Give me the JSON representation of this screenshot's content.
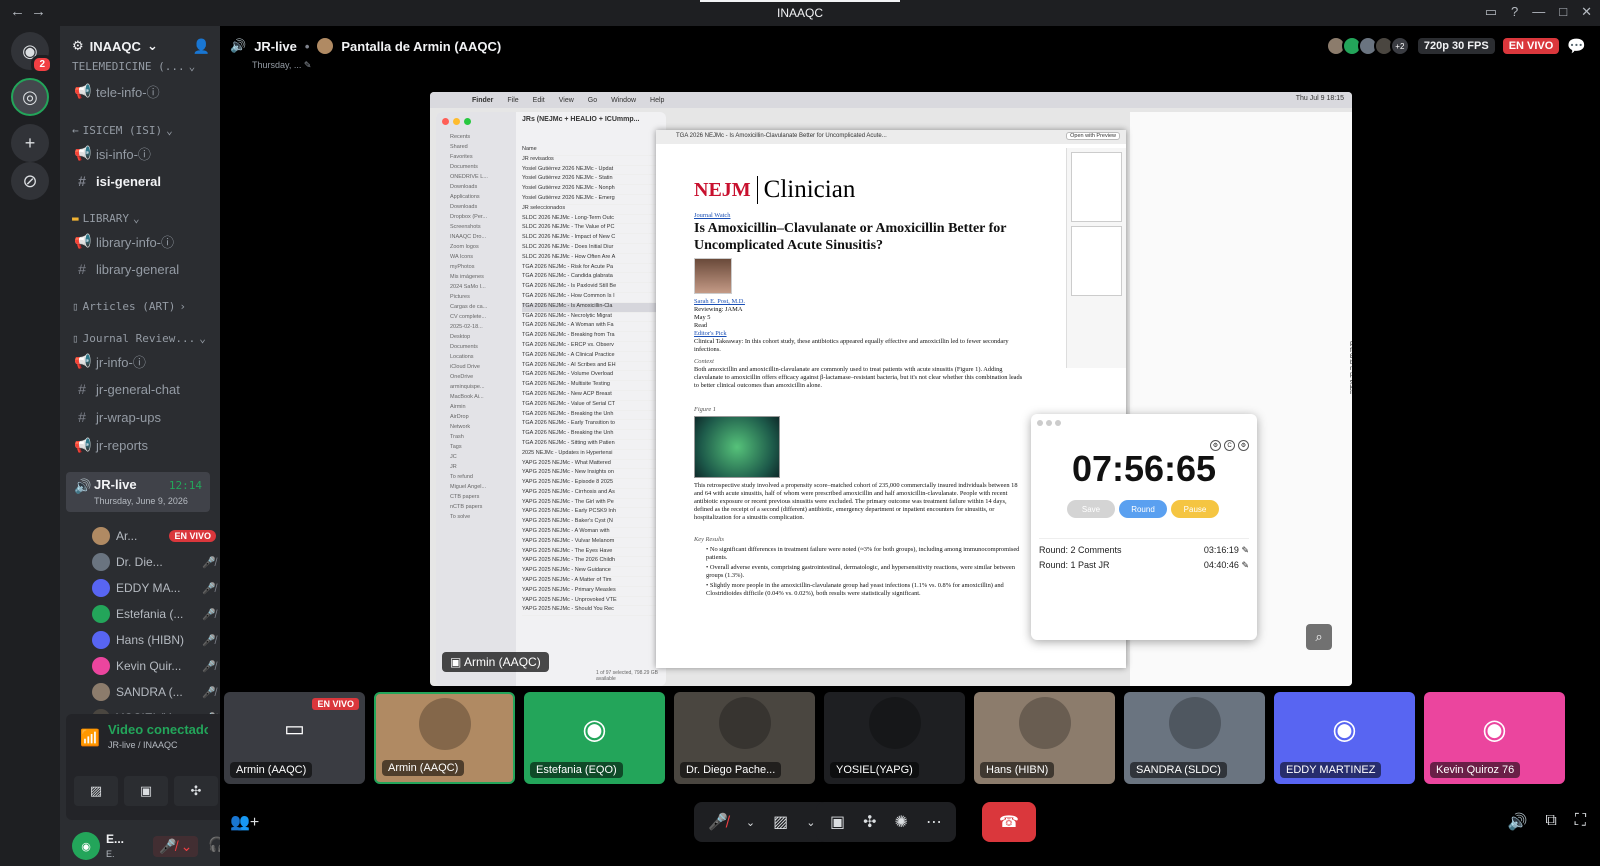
{
  "window": {
    "title": "INAAQC",
    "back": "←",
    "forward": "→"
  },
  "guilds": {
    "dm_badge": "2"
  },
  "server": {
    "name": "INAAQC"
  },
  "channels": {
    "cat_telemedicine": "TELEMEDICINE (...",
    "tele_info": "tele-info-ⓘ",
    "cat_isicem": "ISICEM (ISI)",
    "isi_info": "isi-info-ⓘ",
    "isi_general": "isi-general",
    "cat_library": "LIBRARY",
    "library_info": "library-info-ⓘ",
    "library_general": "library-general",
    "cat_articles": "Articles (ART)",
    "cat_journal": "Journal Review...",
    "jr_info": "jr-info-ⓘ",
    "jr_general_chat": "jr-general-chat",
    "jr_wrap_ups": "jr-wrap-ups",
    "jr_reports": "jr-reports",
    "jr_live": "JR-live",
    "jr_live_time": "12:14",
    "jr_live_date": "Thursday, June 9, 2026"
  },
  "voice_users": [
    {
      "name": "Ar...",
      "live": "EN VIVO"
    },
    {
      "name": "Dr. Die..."
    },
    {
      "name": "EDDY MA..."
    },
    {
      "name": "Estefania (..."
    },
    {
      "name": "Hans (HIBN)"
    },
    {
      "name": "Kevin Quir..."
    },
    {
      "name": "SANDRA (..."
    },
    {
      "name": "YOSIEL(Y..."
    }
  ],
  "voice_panel": {
    "status": "Video conectado",
    "location": "JR-live / INAAQC"
  },
  "user": {
    "name": "E...",
    "sub": "E."
  },
  "stage": {
    "channel": "JR-live",
    "screen_title": "Pantalla de Armin (AAQC)",
    "date": "Thursday, ...",
    "extra_count": "+2",
    "quality": "720p 30 FPS",
    "live": "EN VIVO"
  },
  "screen": {
    "menubar": [
      "Finder",
      "File",
      "Edit",
      "View",
      "Go",
      "Window",
      "Help"
    ],
    "clock": "Thu Jul 9 18:15",
    "finder_path": "JRs (NEJMc + HEALIO + ICUmmp...",
    "finder_sidebar": [
      "Recents",
      "Shared",
      "Favorites",
      "Documents",
      "ONEDRIVE L...",
      "Downloads",
      "Applications",
      "Downloads",
      "Dropbox (Per...",
      "Screenshots",
      "INAAQC Dro...",
      "Zoom logos",
      "WA Icons",
      "myPhotos",
      "Mis imágenes",
      "2024 SaMo I...",
      "Pictures",
      "Cargas de ca...",
      "CV complete...",
      "2025-02-18...",
      "Desktop",
      "Documents",
      "Locations",
      "iCloud Drive",
      "OneDrive",
      "arminquispe...",
      "MacBook Ai...",
      "Airmin",
      "AirDrop",
      "Network",
      "Trash",
      "Tags",
      "JC",
      "JR",
      "To refund",
      "Miguel Angel...",
      "CTB papers",
      "nCTB papers",
      "To solve"
    ],
    "finder_files": [
      "Name",
      "JR revisados",
      "Yosiel Gutiérrez 2026 NEJMc - Updat",
      "Yosiel Gutiérrez 2026 NEJMc - Statin",
      "Yosiel Gutiérrez 2026 NEJMc - Nonph",
      "Yosiel Gutiérrez 2026 NEJMc - Emerg",
      "JR seleccionados",
      "SLDC 2026 NEJMc - Long-Term Outc",
      "SLDC 2026 NEJMc - The Value of PC",
      "SLDC 2026 NEJMc - Impact of New C",
      "SLDC 2026 NEJMc - Does Initial Diur",
      "SLDC 2026 NEJMc - How Often Are A",
      "TGA 2026 NEJMc - Risk for Acute Pa",
      "TGA 2026 NEJMc - Candida glabrata",
      "TGA 2026 NEJMc - Is Paxlovid Still Be",
      "TGA 2026 NEJMc - How Common Is I",
      "TGA 2026 NEJMc - Is Amoxicillin-Cla",
      "TGA 2026 NEJMc - Necrolytic Migrat",
      "TGA 2026 NEJMc - A Woman with Fa",
      "TGA 2026 NEJMc - Breaking from Tra",
      "TGA 2026 NEJMc - ERCP vs. Observ",
      "TGA 2026 NEJMc - A Clinical Practice",
      "TGA 2026 NEJMc - AI Scribes and EH",
      "TGA 2026 NEJMc - Volume Overload",
      "TGA 2026 NEJMc - Multisite Testing",
      "TGA 2026 NEJMc - New ACP Breast",
      "TGA 2026 NEJMc - Value of Serial CT",
      "TGA 2026 NEJMc - Breaking the Unh",
      "TGA 2026 NEJMc - Early Transition to",
      "TGA 2026 NEJMc - Breaking the Unh",
      "TGA 2026 NEJMc - Sitting with Patien",
      "2025 NEJMc - Updates in Hypertensi",
      "YAPG 2025 NEJMc - What Mattered",
      "YAPG 2025 NEJMc - New Insights on",
      "YAPG 2025 NEJMc - Episode 8 2025",
      "YAPG 2025 NEJMc - Cirrhosis and As",
      "YAPG 2025 NEJMc - The Girl with Pe",
      "YAPG 2025 NEJMc - Early PCSK9 Inh",
      "YAPG 2025 NEJMc - Baker's Cyst (N",
      "YAPG 2025 NEJMc - A Woman with",
      "YAPG 2025 NEJMc - Vulvar Melanom",
      "YAPG 2025 NEJMc - The Eyes Have",
      "YAPG 2025 NEJMc - The 2026 Childh",
      "YAPG 2025 NEJMc - New Guidance",
      "YAPG 2025 NEJMc - A Matter of Tim",
      "YAPG 2025 NEJMc - Primary Measles",
      "YAPG 2025 NEJMc - Unprovoked VTE",
      "YAPG 2025 NEJMc - Should You Rec"
    ],
    "pdf_title": "TGA 2026 NEJMc - Is Amoxicillin-Clavulanate Better for Uncomplicated Acute...",
    "pdf_open_btn": "Open with Preview",
    "nejm": "NEJM",
    "clinician": "Clinician",
    "journal_watch": "Journal Watch",
    "headline": "Is Amoxicillin–Clavulanate or Amoxicillin Better for Uncomplicated Acute Sinusitis?",
    "author": "Sarah E. Post, M.D.",
    "reviewing": "Reviewing: JAMA",
    "date": "May 5",
    "read": "Read",
    "editors_pick": "Editor's Pick",
    "takeaway": "Clinical Takeaway: In this cohort study, these antibiotics appeared equally effective and amoxicillin led to fewer secondary infections.",
    "context_h": "Context",
    "context": "Both amoxicillin and amoxicillin-clavulanate are commonly used to treat patients with acute sinusitis (Figure 1). Adding clavulanate to amoxicillin offers efficacy against β-lactamase–resistant bacteria, but it's not clear whether this combination leads to better clinical outcomes than amoxicillin alone.",
    "figure_h": "Figure 1",
    "study": "This retrospective study involved a propensity score–matched cohort of 235,000 commercially insured individuals between 18 and 64 with acute sinusitis, half of whom were prescribed amoxicillin and half amoxicillin-clavulanate. People with recent antibiotic exposure or recent previous sinusitis were excluded. The primary outcome was treatment failure within 14 days, defined as the receipt of a second (different) antibiotic, emergency department or inpatient encounters for sinusitis, or hospitalization for a sinusitis complication.",
    "results_h": "Key Results",
    "results": [
      "• No significant differences in treatment failure were noted (≈3% for both groups), including among immunocompromised patients.",
      "• Overall adverse events, comprising gastrointestinal, dermatologic, and hypersensitivity reactions, were similar between groups (1.3%).",
      "• Slightly more people in the amoxicillin-clavulanate group had yeast infections (1.1% vs. 0.8% for amoxicillin) and Clostridioides difficile (0.04% vs. 0.02%), both results were statistically significant."
    ],
    "finder_status": "1 of 97 selected, 798.29 GB available",
    "right_notes": [
      "aeruginosa.",
      "P for 3d",
      "used by most pxs (■) -> unclear if beta-",
      "s reasonable",
      "niel",
      "unity-",
      "26"
    ],
    "timer": {
      "clock": "07:56:65",
      "save": "Save",
      "round": "Round",
      "pause": "Pause",
      "rows": [
        {
          "label": "Round: 2  Comments",
          "time": "03:16:19"
        },
        {
          "label": "Round: 1  Past JR",
          "time": "04:40:46"
        }
      ]
    },
    "nametag": "Armin (AAQC)"
  },
  "tiles": [
    {
      "label": "Armin (AAQC)",
      "live": "EN VIVO",
      "bg": "#3a3c42"
    },
    {
      "label": "Armin (AAQC)",
      "bg": "#b08a63"
    },
    {
      "label": "Estefania (EQO)",
      "bg": "#23a55a"
    },
    {
      "label": "Dr. Diego Pache...",
      "bg": "#4a4640"
    },
    {
      "label": "YOSIEL(YAPG)",
      "bg": "#1e1f22"
    },
    {
      "label": "Hans (HIBN)",
      "bg": "#8c7c6c"
    },
    {
      "label": "SANDRA (SLDC)",
      "bg": "#6a7480"
    },
    {
      "label": "EDDY MARTINEZ",
      "bg": "#5865f2"
    },
    {
      "label": "Kevin Quiroz 76",
      "bg": "#eb459e"
    }
  ]
}
